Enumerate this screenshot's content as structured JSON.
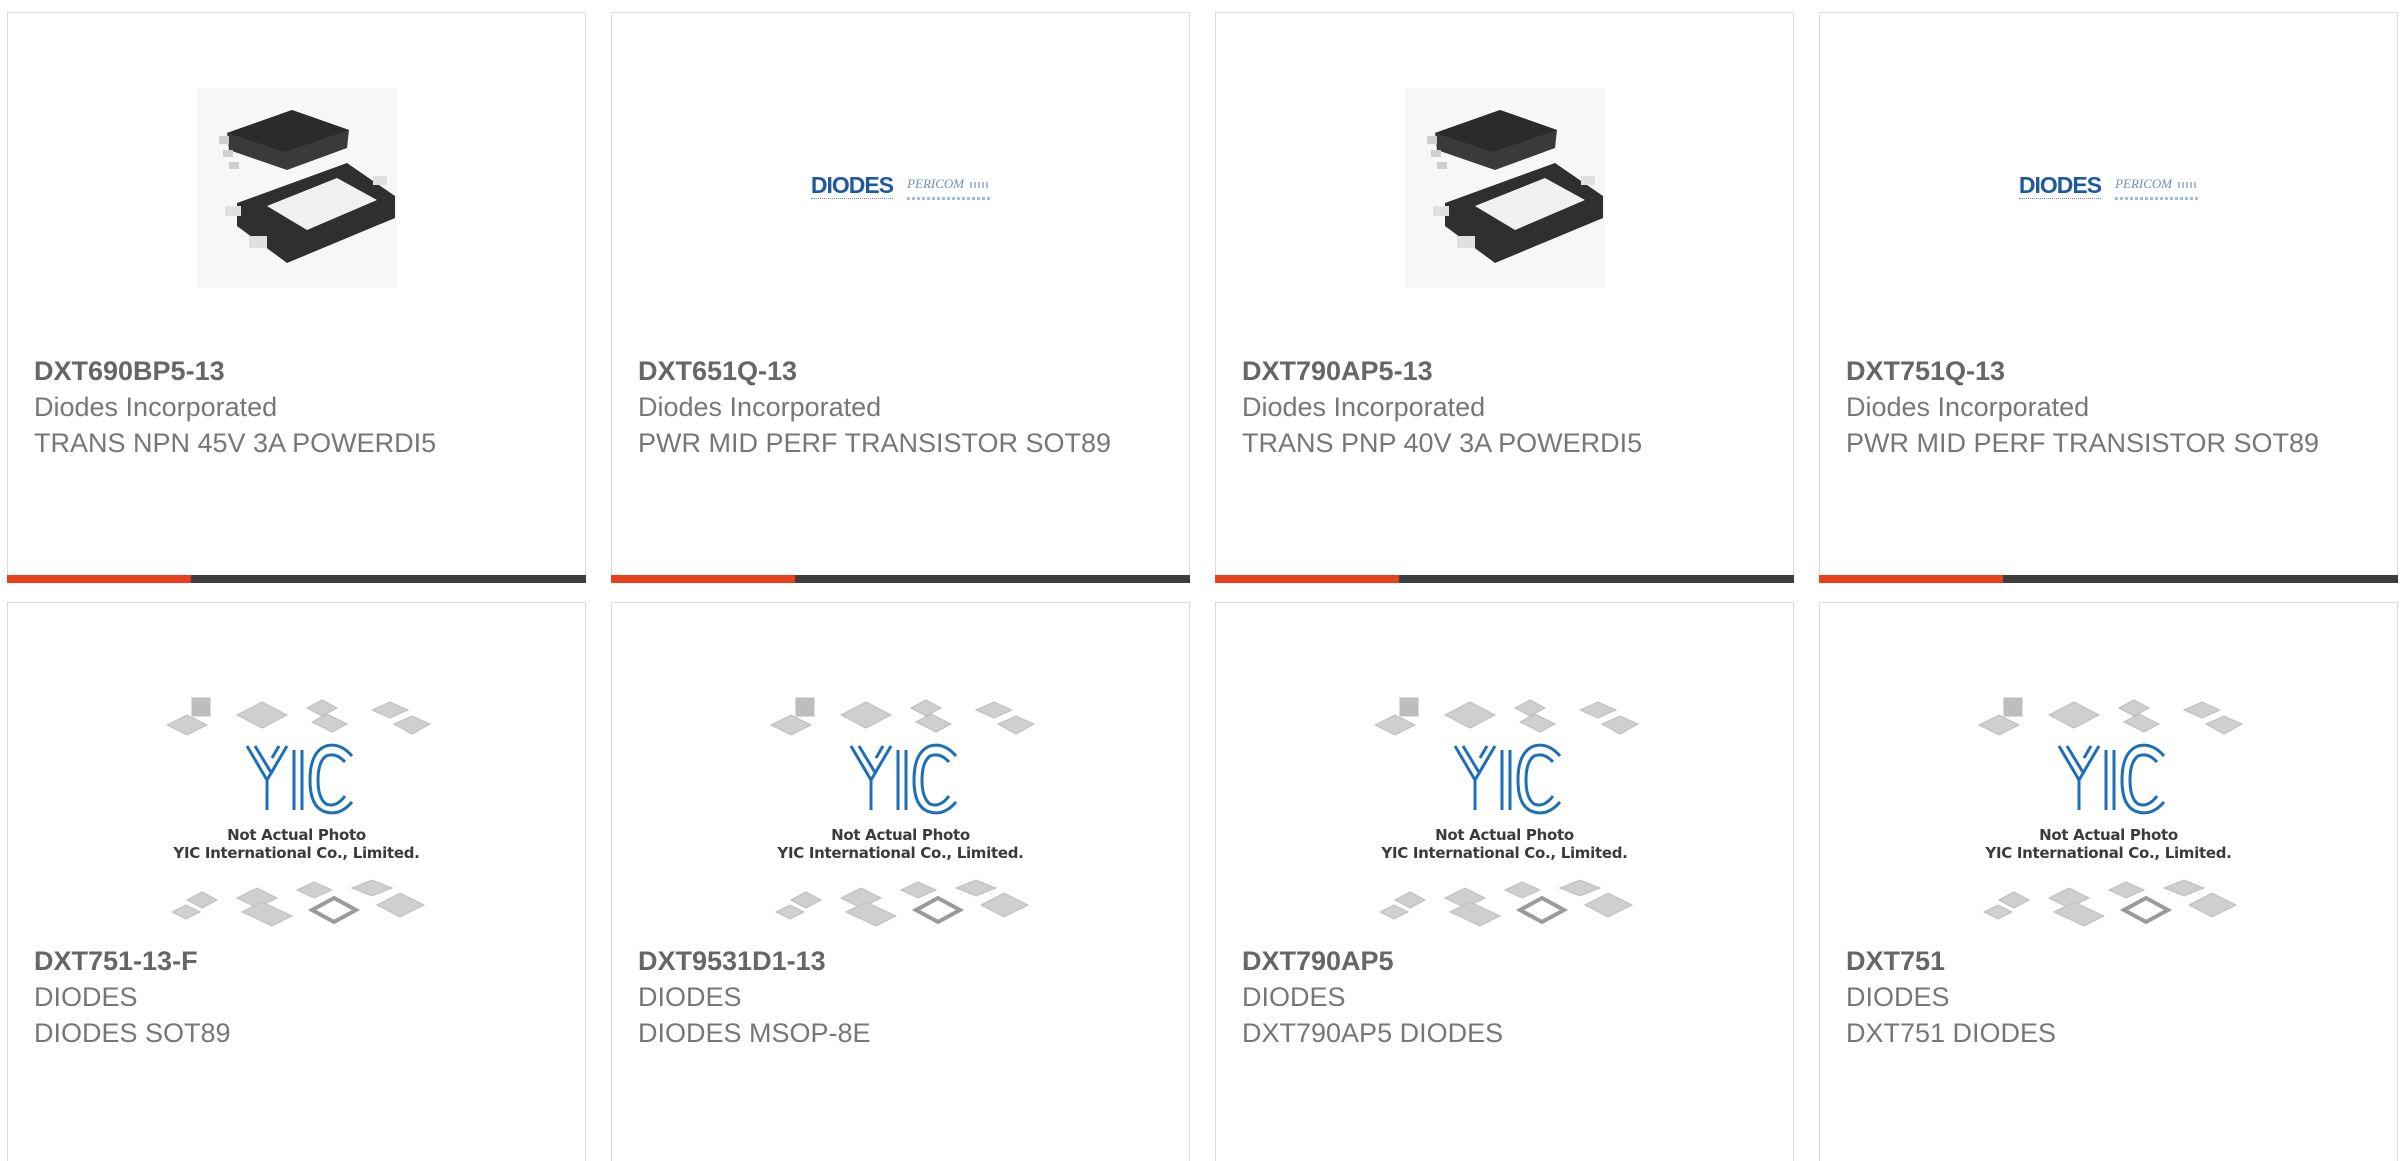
{
  "colors": {
    "accent": "#e8401c",
    "bar": "#3d3d3d",
    "border": "#dcdcdc",
    "text": "#777777",
    "logo_blue": "#1f5aa0"
  },
  "cards": [
    {
      "part_number": "DXT690BP5-13",
      "manufacturer": "Diodes Incorporated",
      "description": "TRANS NPN 45V 3A POWERDI5",
      "image": "powerdi5-package-photo"
    },
    {
      "part_number": "DXT651Q-13",
      "manufacturer": "Diodes Incorporated",
      "description": "PWR MID PERF TRANSISTOR SOT89",
      "image": "diodes-pericom-logo",
      "logo_text": "DIODES",
      "logo_subtext": "PERICOM"
    },
    {
      "part_number": "DXT790AP5-13",
      "manufacturer": "Diodes Incorporated",
      "description": "TRANS PNP 40V 3A POWERDI5",
      "image": "powerdi5-package-photo"
    },
    {
      "part_number": "DXT751Q-13",
      "manufacturer": "Diodes Incorporated",
      "description": "PWR MID PERF TRANSISTOR SOT89",
      "image": "diodes-pericom-logo",
      "logo_text": "DIODES",
      "logo_subtext": "PERICOM"
    },
    {
      "part_number": "DXT751-13-F",
      "manufacturer": "DIODES",
      "description": "DIODES SOT89",
      "image": "yic-not-actual-photo"
    },
    {
      "part_number": "DXT9531D1-13",
      "manufacturer": "DIODES",
      "description": "DIODES MSOP-8E",
      "image": "yic-not-actual-photo"
    },
    {
      "part_number": "DXT790AP5",
      "manufacturer": "DIODES",
      "description": "DXT790AP5 DIODES",
      "image": "yic-not-actual-photo"
    },
    {
      "part_number": "DXT751",
      "manufacturer": "DIODES",
      "description": "DXT751 DIODES",
      "image": "yic-not-actual-photo"
    }
  ],
  "placeholder": {
    "logo": "YIC",
    "line1": "Not Actual Photo",
    "line2": "YIC International Co., Limited."
  }
}
